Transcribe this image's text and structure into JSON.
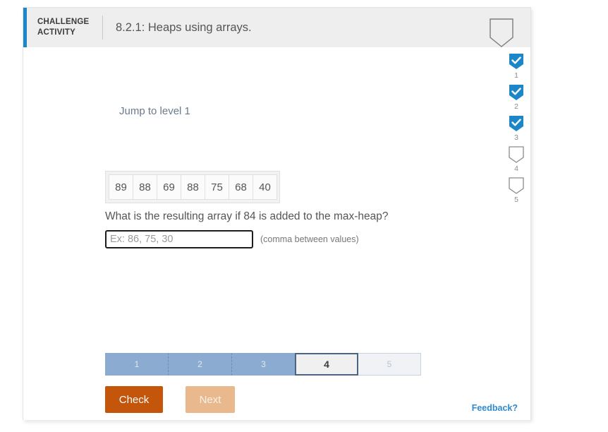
{
  "header": {
    "label_line1": "CHALLENGE",
    "label_line2": "ACTIVITY",
    "title": "8.2.1: Heaps using arrays.",
    "bookmark_icon": "shield-outline-icon",
    "accent_color": "#1b87c9"
  },
  "main": {
    "jump_link": "Jump to level 1",
    "array": {
      "values": [
        "89",
        "88",
        "69",
        "88",
        "75",
        "68",
        "40"
      ]
    },
    "question": "What is the resulting array if 84 is added to the max-heap?",
    "answer": {
      "value": "",
      "placeholder": "Ex: 86, 75, 30",
      "hint": "(comma between values)"
    },
    "segments": [
      {
        "label": "1",
        "state": "done"
      },
      {
        "label": "2",
        "state": "done"
      },
      {
        "label": "3",
        "state": "done"
      },
      {
        "label": "4",
        "state": "current"
      },
      {
        "label": "5",
        "state": "todo"
      }
    ],
    "buttons": {
      "check": "Check",
      "next": "Next"
    },
    "feedback": "Feedback?"
  },
  "rail": {
    "items": [
      {
        "number": "1",
        "state": "complete",
        "icon": "shield-check-icon"
      },
      {
        "number": "2",
        "state": "complete",
        "icon": "shield-check-icon"
      },
      {
        "number": "3",
        "state": "complete",
        "icon": "shield-check-icon"
      },
      {
        "number": "4",
        "state": "incomplete",
        "icon": "shield-outline-icon"
      },
      {
        "number": "5",
        "state": "incomplete",
        "icon": "shield-outline-icon"
      }
    ],
    "complete_color": "#1b87c9",
    "incomplete_color": "#8c8c8c"
  }
}
